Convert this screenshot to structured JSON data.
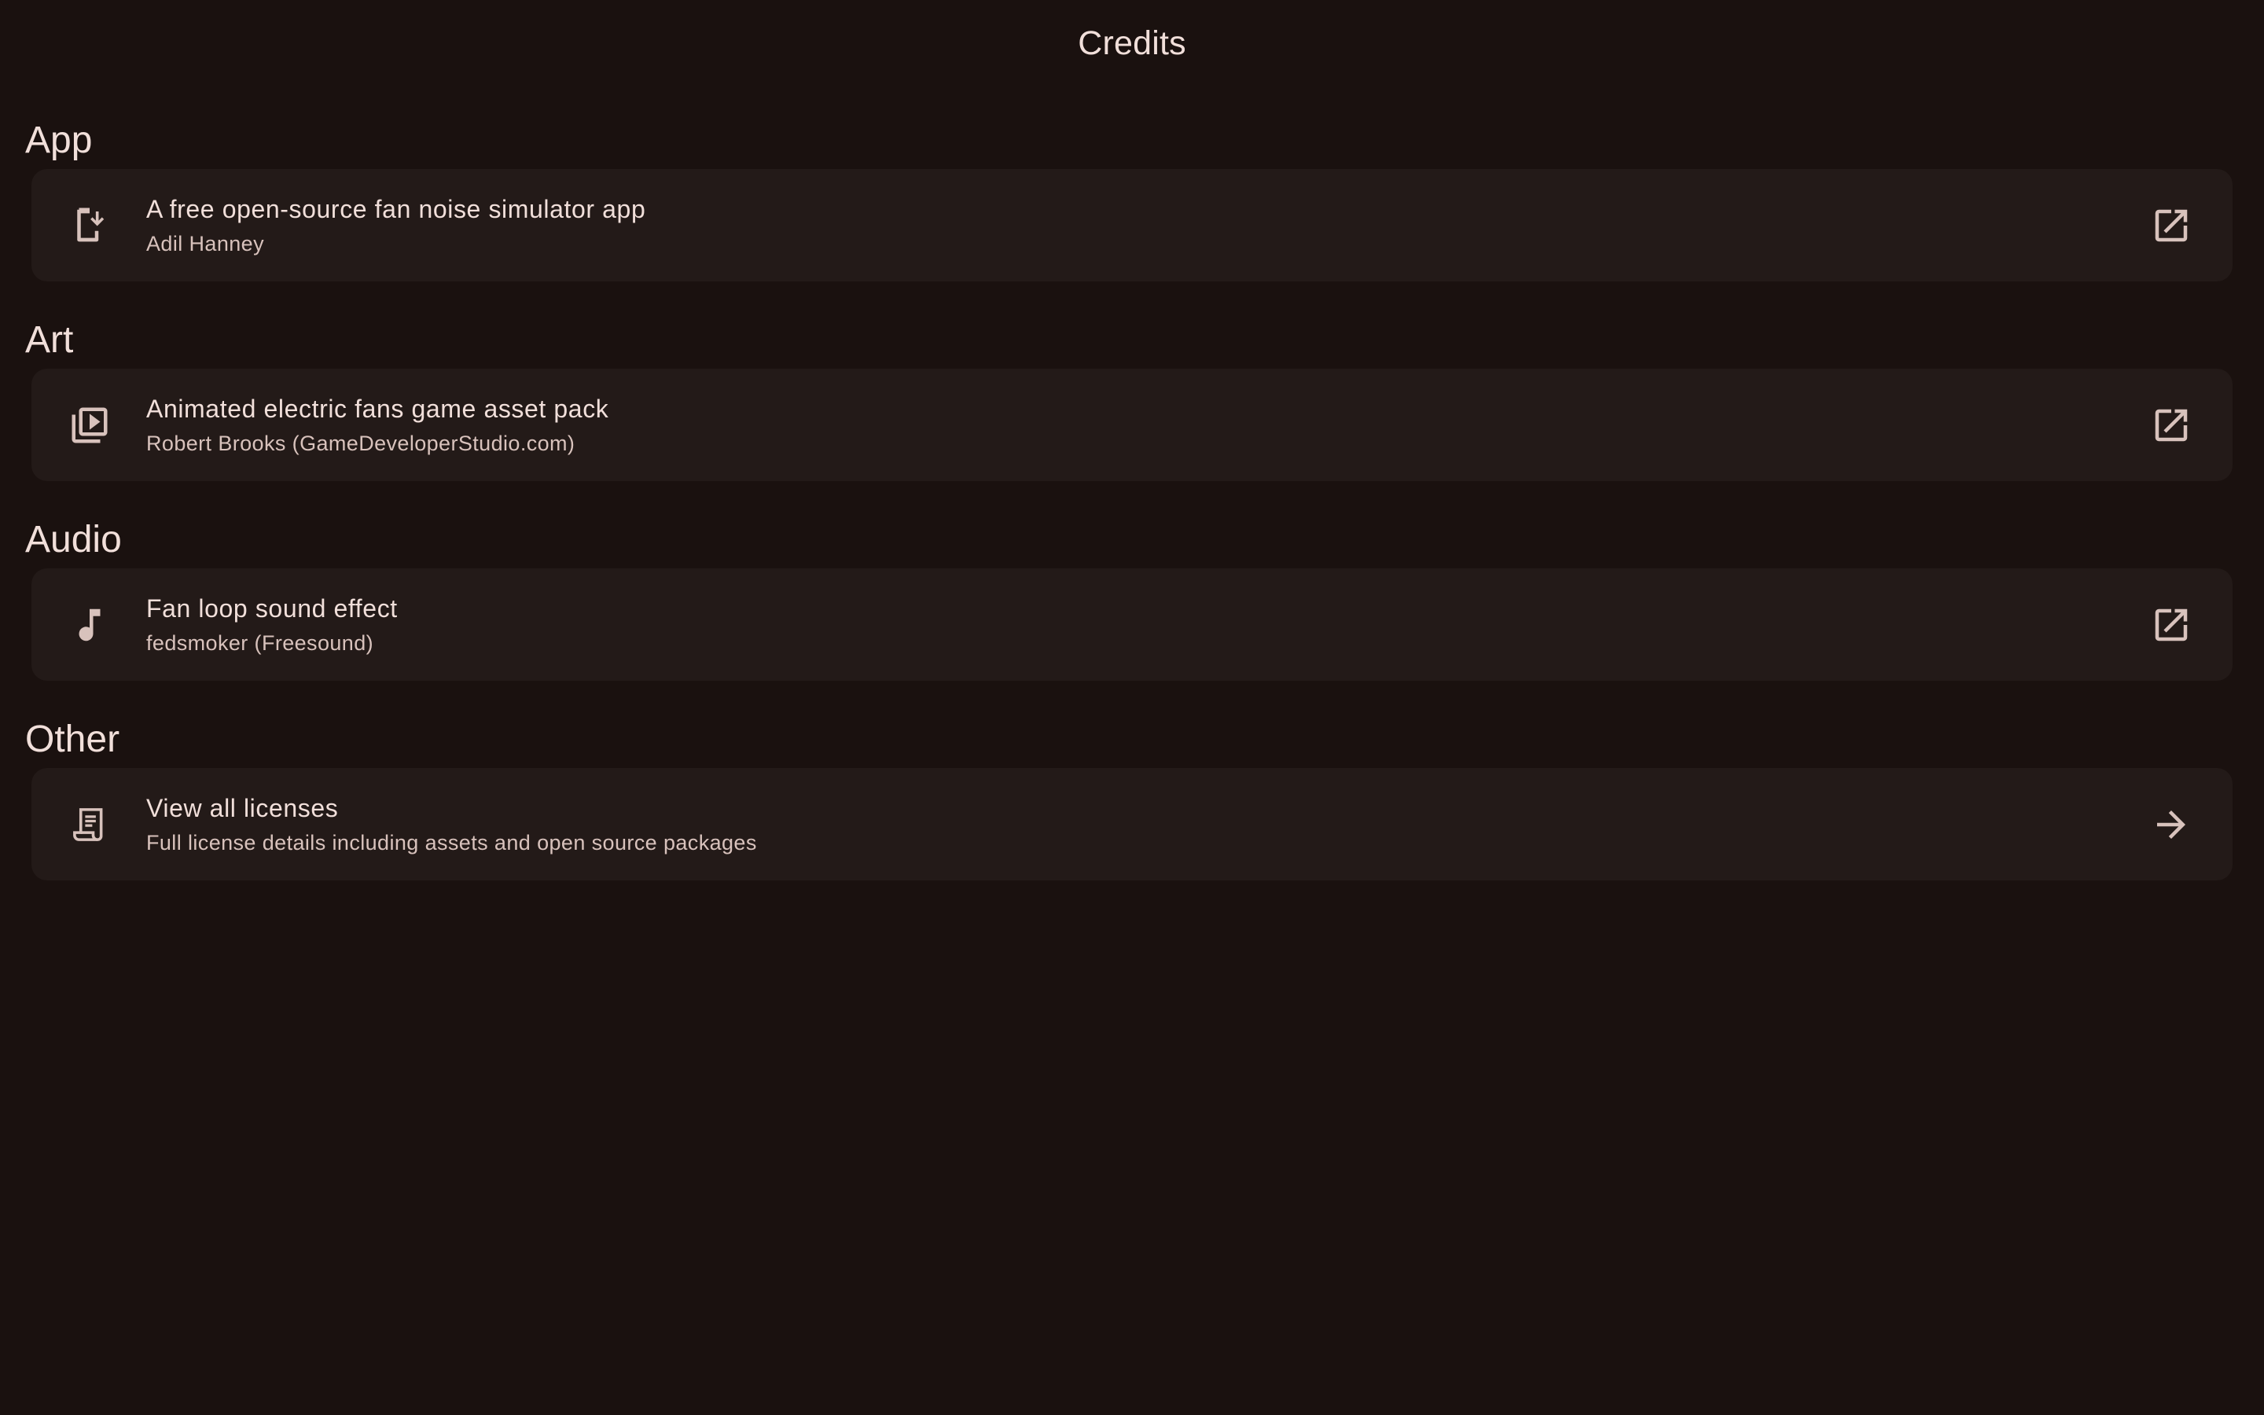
{
  "header": {
    "title": "Credits"
  },
  "sections": [
    {
      "title": "App",
      "item": {
        "headline": "A free open-source fan noise simulator app",
        "supporting": "Adil Hanney",
        "leading_icon": "install-mobile-icon",
        "trailing_icon": "open-in-new-icon"
      }
    },
    {
      "title": "Art",
      "item": {
        "headline": "Animated electric fans game asset pack",
        "supporting": "Robert Brooks (GameDeveloperStudio.com)",
        "leading_icon": "video-library-icon",
        "trailing_icon": "open-in-new-icon"
      }
    },
    {
      "title": "Audio",
      "item": {
        "headline": "Fan loop sound effect",
        "supporting": "fedsmoker (Freesound)",
        "leading_icon": "music-note-icon",
        "trailing_icon": "open-in-new-icon"
      }
    },
    {
      "title": "Other",
      "item": {
        "headline": "View all licenses",
        "supporting": "Full license details including assets and open source packages",
        "leading_icon": "receipt-long-icon",
        "trailing_icon": "arrow-forward-icon"
      }
    }
  ],
  "colors": {
    "background": "#1a110f",
    "card": "#231a18",
    "on_surface": "#f1dfda",
    "on_surface_variant": "#d8c2bc"
  }
}
